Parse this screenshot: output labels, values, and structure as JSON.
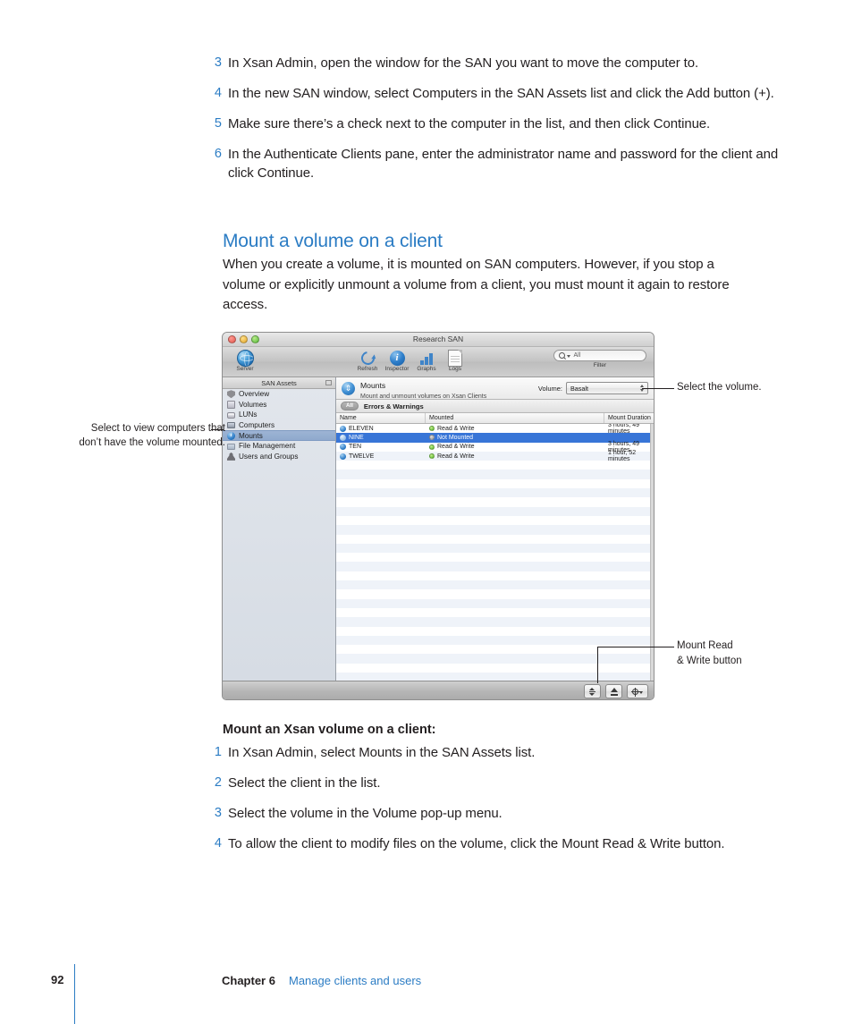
{
  "top_steps": [
    {
      "num": "3",
      "text": "In Xsan Admin, open the window for the SAN you want to move the computer to."
    },
    {
      "num": "4",
      "text": "In the new SAN window, select Computers in the SAN Assets list and click the Add button (+)."
    },
    {
      "num": "5",
      "text": "Make sure there’s a check next to the computer in the list, and then click Continue."
    },
    {
      "num": "6",
      "text": "In the Authenticate Clients pane, enter the administrator name and password for the client and click Continue."
    }
  ],
  "section": {
    "heading": "Mount a volume on a client",
    "body": "When you create a volume, it is mounted on SAN computers. However, if you stop a volume or explicitly unmount a volume from a client, you must mount it again to restore access."
  },
  "screenshot": {
    "window_title": "Research SAN",
    "toolbar": {
      "server": "Server",
      "refresh": "Refresh",
      "inspector": "Inspector",
      "graphs": "Graphs",
      "logs": "Logs",
      "search_value": "All",
      "filter_label": "Filter"
    },
    "sidebar": {
      "header": "SAN Assets",
      "items": [
        {
          "label": "Overview",
          "icon": "shield-icon",
          "selected": false
        },
        {
          "label": "Volumes",
          "icon": "volume-icon",
          "selected": false
        },
        {
          "label": "LUNs",
          "icon": "lun-icon",
          "selected": false
        },
        {
          "label": "Computers",
          "icon": "computer-icon",
          "selected": false
        },
        {
          "label": "Mounts",
          "icon": "mounts-icon",
          "selected": true
        },
        {
          "label": "File Management",
          "icon": "folder-icon",
          "selected": false
        },
        {
          "label": "Users and Groups",
          "icon": "user-icon",
          "selected": false
        }
      ]
    },
    "pane": {
      "title": "Mounts",
      "subtitle": "Mount and unmount volumes on Xsan Clients",
      "volume_label": "Volume:",
      "volume_value": "Basalt",
      "filter_badge": "All",
      "errors_label": "Errors & Warnings"
    },
    "table": {
      "columns": [
        "Name",
        "Mounted",
        "Mount Duration"
      ],
      "rows": [
        {
          "name": "ELEVEN",
          "mounted": "Read & Write",
          "duration": "3 hours, 49 minutes",
          "status": "green",
          "selected": false
        },
        {
          "name": "NINE",
          "mounted": "Not Mounted",
          "duration": "",
          "status": "gray",
          "selected": true
        },
        {
          "name": "TEN",
          "mounted": "Read & Write",
          "duration": "3 hours, 49 minutes",
          "status": "green",
          "selected": false
        },
        {
          "name": "TWELVE",
          "mounted": "Read & Write",
          "duration": "1 hour, 52 minutes",
          "status": "green",
          "selected": false
        }
      ]
    },
    "bottom_buttons": [
      "mount-read-write-button",
      "unmount-eject-button",
      "action-gear-button"
    ]
  },
  "callouts": {
    "left": "Select to view computers that don’t have the volume mounted.",
    "volume": "Select the volume.",
    "mount_button_line1": "Mount Read",
    "mount_button_line2": "& Write button"
  },
  "subheading": "Mount an Xsan volume on a client:",
  "bottom_steps": [
    {
      "num": "1",
      "text": "In Xsan Admin, select Mounts in the SAN Assets list."
    },
    {
      "num": "2",
      "text": "Select the client in the list."
    },
    {
      "num": "3",
      "text": "Select the volume in the Volume pop-up menu."
    },
    {
      "num": "4",
      "text": "To allow the client to modify files on the volume, click the Mount Read & Write button."
    }
  ],
  "footer": {
    "page_number": "92",
    "chapter": "Chapter 6",
    "title": "Manage clients and users"
  },
  "colors": {
    "accent_blue": "#2b7cc4",
    "selection_blue": "#3875d7",
    "text": "#231f20"
  }
}
